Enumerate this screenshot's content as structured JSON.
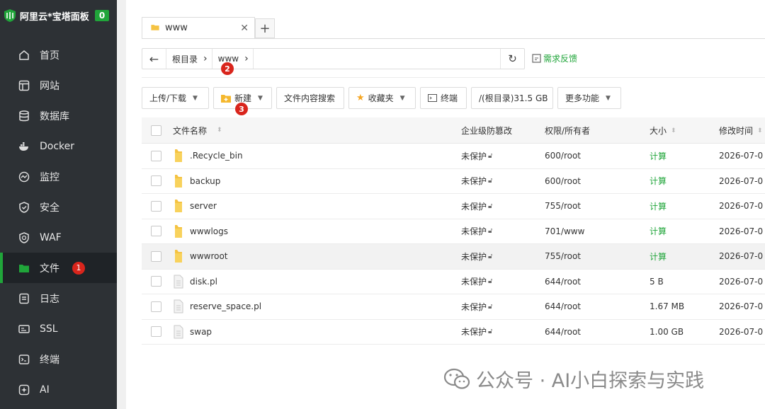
{
  "sidebar": {
    "brand_title": "阿里云*宝塔面板",
    "brand_badge": "0",
    "items": [
      {
        "label": "首页",
        "icon": "home-icon"
      },
      {
        "label": "网站",
        "icon": "website-icon"
      },
      {
        "label": "数据库",
        "icon": "database-icon"
      },
      {
        "label": "Docker",
        "icon": "docker-icon"
      },
      {
        "label": "监控",
        "icon": "monitor-icon"
      },
      {
        "label": "安全",
        "icon": "shield-icon"
      },
      {
        "label": "WAF",
        "icon": "waf-icon"
      },
      {
        "label": "文件",
        "icon": "folder-icon",
        "active": true,
        "badge": "1"
      },
      {
        "label": "日志",
        "icon": "log-icon"
      },
      {
        "label": "SSL",
        "icon": "ssl-icon"
      },
      {
        "label": "终端",
        "icon": "terminal-icon"
      },
      {
        "label": "AI",
        "icon": "ai-icon"
      }
    ]
  },
  "tabs": [
    {
      "label": "www"
    }
  ],
  "address": {
    "crumbs": [
      "根目录",
      "www"
    ],
    "feedback": "需求反馈"
  },
  "annotations": {
    "step2": "2",
    "step3": "3"
  },
  "toolbar": {
    "upload": "上传/下载",
    "new": "新建",
    "search": "文件内容搜索",
    "favorites": "收藏夹",
    "terminal": "终端",
    "disk": "/(根目录)31.5 GB",
    "more": "更多功能"
  },
  "table": {
    "headers": {
      "name": "文件名称",
      "protect": "企业级防篡改",
      "perm": "权限/所有者",
      "size": "大小",
      "time": "修改时间"
    },
    "rows": [
      {
        "type": "folder",
        "name": ".Recycle_bin",
        "protect": "未保护",
        "perm": "600/root",
        "size": "计算",
        "time": "2026-07-0"
      },
      {
        "type": "folder",
        "name": "backup",
        "protect": "未保护",
        "perm": "600/root",
        "size": "计算",
        "time": "2026-07-0"
      },
      {
        "type": "folder",
        "name": "server",
        "protect": "未保护",
        "perm": "755/root",
        "size": "计算",
        "time": "2026-07-0"
      },
      {
        "type": "folder",
        "name": "wwwlogs",
        "protect": "未保护",
        "perm": "701/www",
        "size": "计算",
        "time": "2026-07-0"
      },
      {
        "type": "folder",
        "name": "wwwroot",
        "protect": "未保护",
        "perm": "755/root",
        "size": "计算",
        "time": "2026-07-0"
      },
      {
        "type": "file",
        "name": "disk.pl",
        "protect": "未保护",
        "perm": "644/root",
        "size": "5 B",
        "time": "2026-07-0"
      },
      {
        "type": "file",
        "name": "reserve_space.pl",
        "protect": "未保护",
        "perm": "644/root",
        "size": "1.67 MB",
        "time": "2026-07-0"
      },
      {
        "type": "file",
        "name": "swap",
        "protect": "未保护",
        "perm": "644/root",
        "size": "1.00 GB",
        "time": "2026-07-0"
      }
    ]
  },
  "watermark": "公众号 · AI小白探索与实践",
  "colors": {
    "accent": "#20a53a",
    "sidebar": "#2d3135",
    "badge": "#d9251c"
  }
}
